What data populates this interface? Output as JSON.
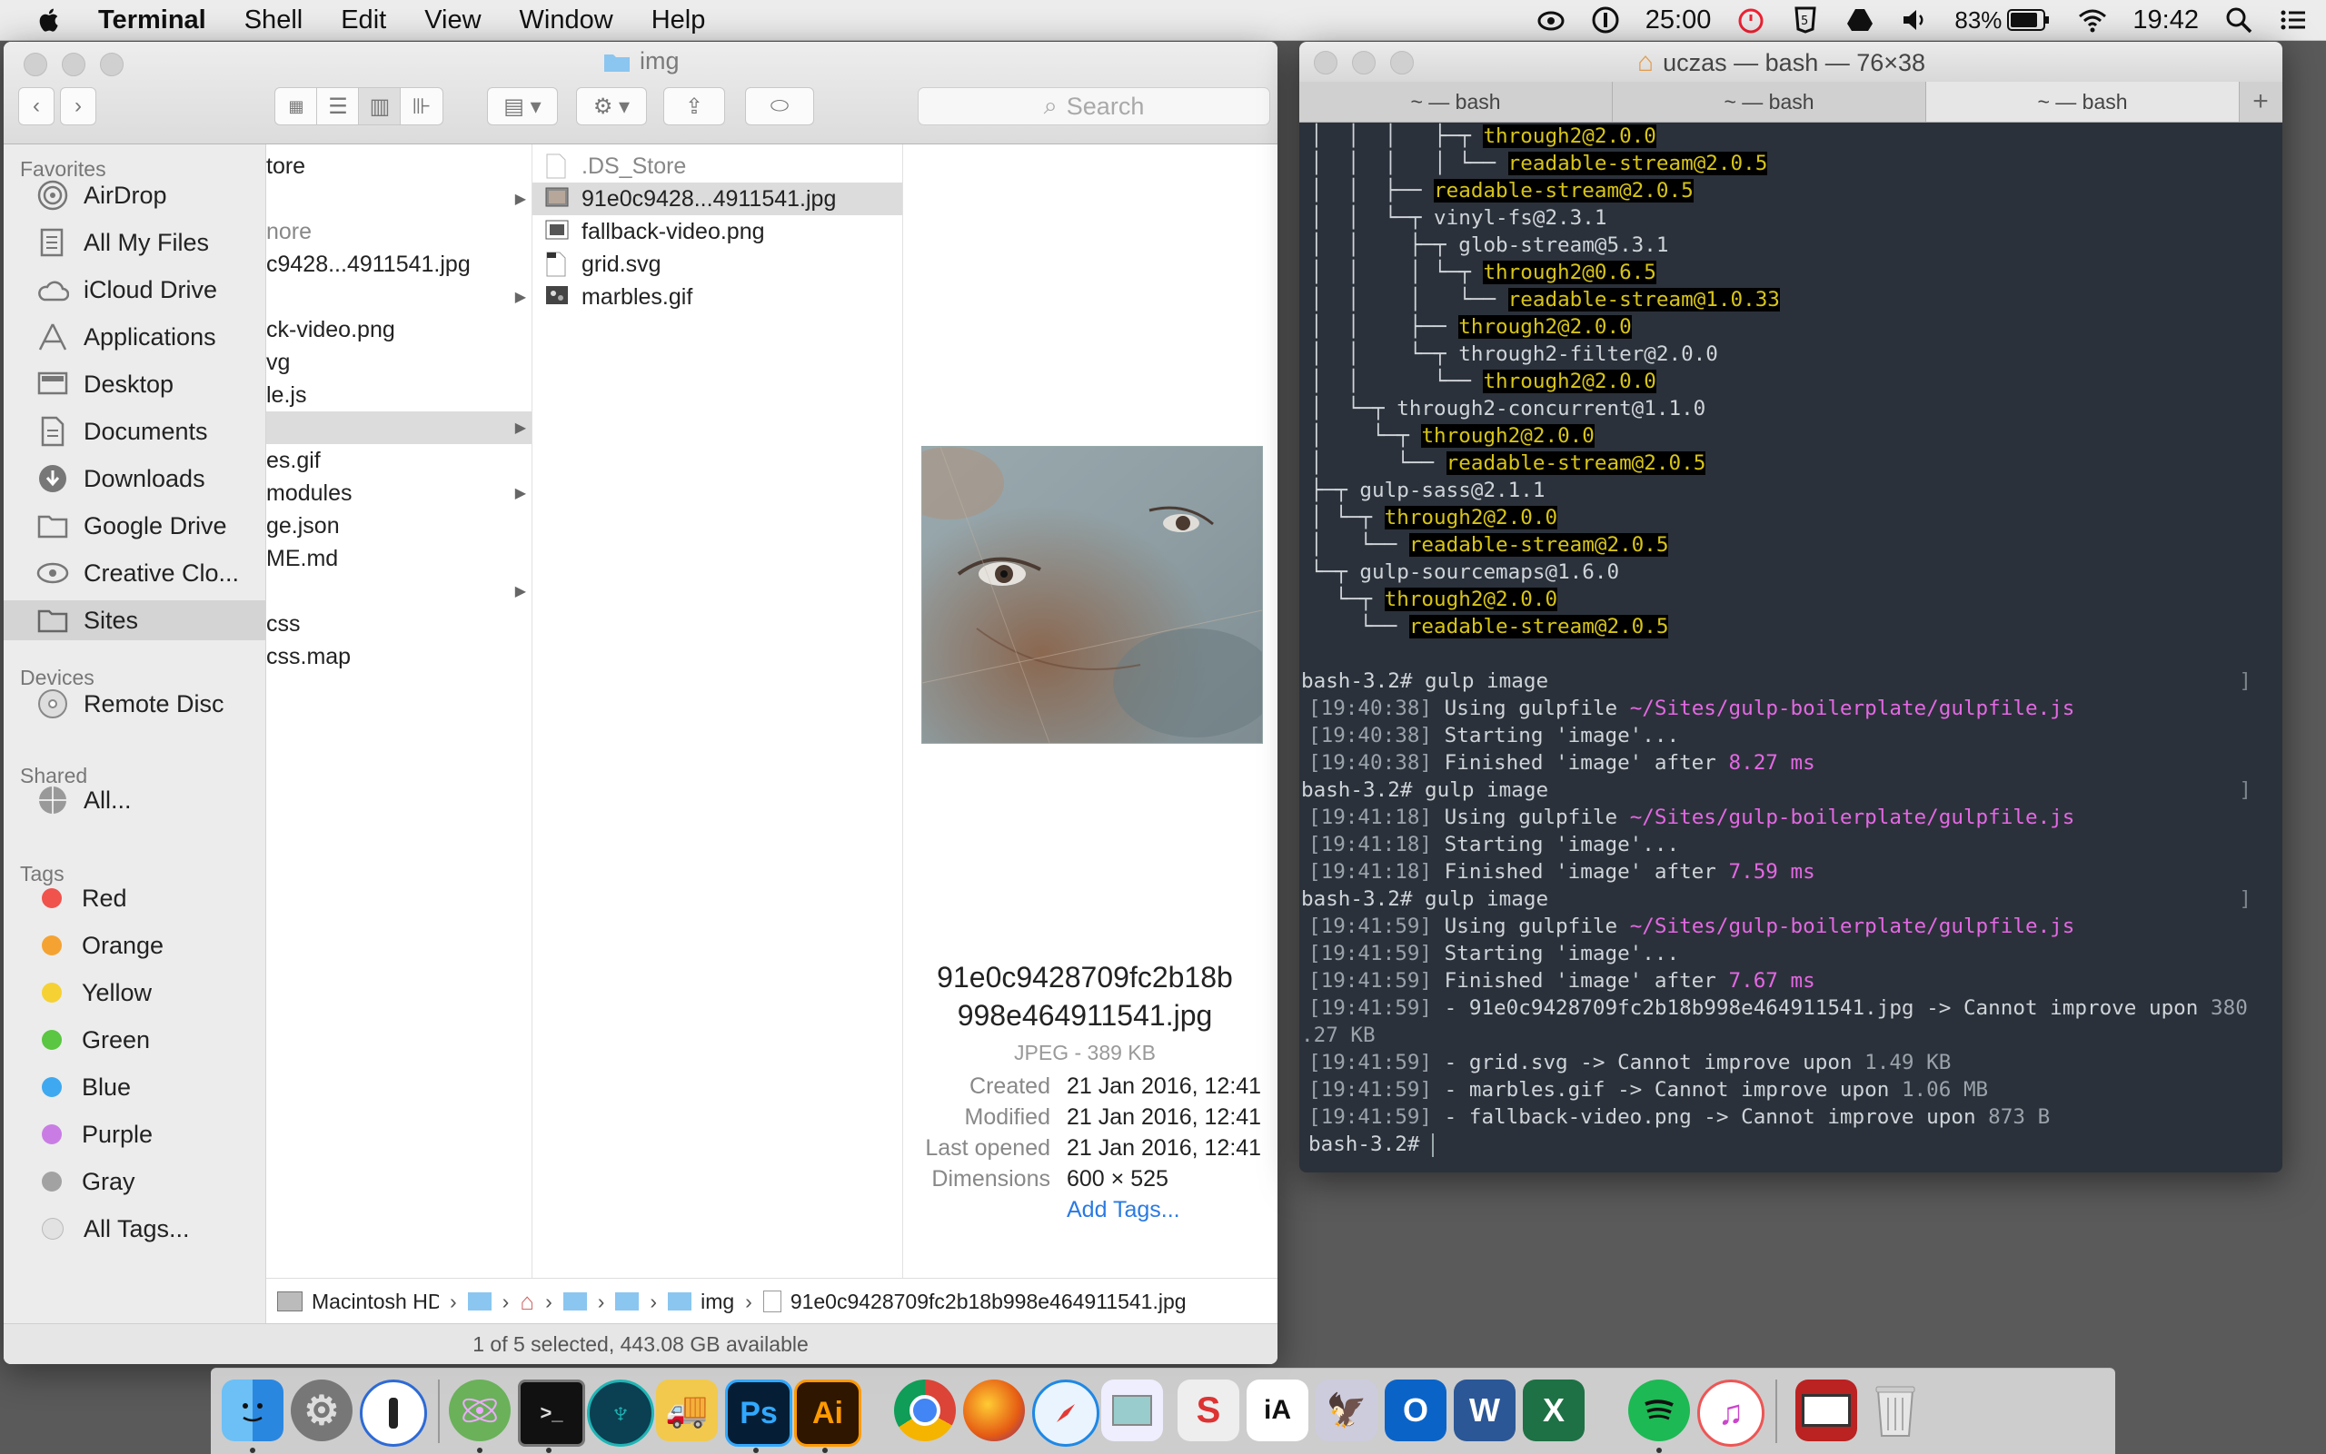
{
  "menubar": {
    "app": "Terminal",
    "items": [
      "Shell",
      "Edit",
      "View",
      "Window",
      "Help"
    ],
    "timer": "25:00",
    "battery": "83%",
    "clock": "19:42"
  },
  "finder": {
    "title": "img",
    "search_placeholder": "Search",
    "sidebar": {
      "favorites_header": "Favorites",
      "favorites": [
        "AirDrop",
        "All My Files",
        "iCloud Drive",
        "Applications",
        "Desktop",
        "Documents",
        "Downloads",
        "Google Drive",
        "Creative Clo...",
        "Sites"
      ],
      "devices_header": "Devices",
      "devices": [
        "Remote Disc"
      ],
      "shared_header": "Shared",
      "shared": [
        "All..."
      ],
      "tags_header": "Tags",
      "tags": [
        {
          "label": "Red",
          "color": "#f0534c"
        },
        {
          "label": "Orange",
          "color": "#f4a332"
        },
        {
          "label": "Yellow",
          "color": "#f6d134"
        },
        {
          "label": "Green",
          "color": "#5ac641"
        },
        {
          "label": "Blue",
          "color": "#3ea9f0"
        },
        {
          "label": "Purple",
          "color": "#c97de4"
        },
        {
          "label": "Gray",
          "color": "#a2a2a2"
        },
        {
          "label": "All Tags...",
          "color": "#e2e2e2"
        }
      ]
    },
    "column1": [
      "tore",
      "",
      "nore",
      "c9428...4911541.jpg",
      "",
      "ck-video.png",
      "vg",
      "le.js",
      "",
      "es.gif",
      "modules",
      "ge.json",
      "ME.md",
      "",
      "css",
      "css.map"
    ],
    "column2": [
      ".DS_Store",
      "91e0c9428...4911541.jpg",
      "fallback-video.png",
      "grid.svg",
      "marbles.gif"
    ],
    "preview": {
      "name_line1": "91e0c9428709fc2b18b",
      "name_line2": "998e464911541.jpg",
      "kind": "JPEG - 389 KB",
      "created_label": "Created",
      "created": "21 Jan 2016, 12:41",
      "modified_label": "Modified",
      "modified": "21 Jan 2016, 12:41",
      "opened_label": "Last opened",
      "opened": "21 Jan 2016, 12:41",
      "dimensions_label": "Dimensions",
      "dimensions": "600 × 525",
      "add_tags": "Add Tags..."
    },
    "pathbar": [
      "Macintosh HD",
      "img",
      "91e0c9428709fc2b18b998e464911541.jpg"
    ],
    "status": "1 of 5 selected, 443.08 GB available"
  },
  "terminal": {
    "title": "uczas — bash — 76×38",
    "tabs": [
      "~ — bash",
      "~ — bash",
      "~ — bash"
    ],
    "tree": [
      {
        "prefix": "│  │  │   ├─┬ ",
        "pkg": "through2@2.0.0"
      },
      {
        "prefix": "│  │  │   │ └── ",
        "pkg": "readable-stream@2.0.5"
      },
      {
        "prefix": "│  │  ├── ",
        "pkg": "readable-stream@2.0.5"
      },
      {
        "prefix": "│  │  └─┬ ",
        "plain": "vinyl-fs@2.3.1"
      },
      {
        "prefix": "│  │    ├─┬ ",
        "plain": "glob-stream@5.3.1"
      },
      {
        "prefix": "│  │    │ └─┬ ",
        "pkg": "through2@0.6.5"
      },
      {
        "prefix": "│  │    │   └── ",
        "pkg": "readable-stream@1.0.33"
      },
      {
        "prefix": "│  │    ├── ",
        "pkg": "through2@2.0.0"
      },
      {
        "prefix": "│  │    └─┬ ",
        "plain": "through2-filter@2.0.0"
      },
      {
        "prefix": "│  │      └── ",
        "pkg": "through2@2.0.0"
      },
      {
        "prefix": "│  └─┬ ",
        "plain": "through2-concurrent@1.1.0"
      },
      {
        "prefix": "│    └─┬ ",
        "pkg": "through2@2.0.0"
      },
      {
        "prefix": "│      └── ",
        "pkg": "readable-stream@2.0.5"
      },
      {
        "prefix": "├─┬ ",
        "plain": "gulp-sass@2.1.1"
      },
      {
        "prefix": "│ └─┬ ",
        "pkg": "through2@2.0.0"
      },
      {
        "prefix": "│   └── ",
        "pkg": "readable-stream@2.0.5"
      },
      {
        "prefix": "└─┬ ",
        "plain": "gulp-sourcemaps@1.6.0"
      },
      {
        "prefix": "  └─┬ ",
        "pkg": "through2@2.0.0"
      },
      {
        "prefix": "    └── ",
        "pkg": "readable-stream@2.0.5"
      }
    ],
    "log": [
      {
        "type": "prompt",
        "text": "bash-3.2# gulp image"
      },
      {
        "ts": "[19:40:38]",
        "a": " Using gulpfile ",
        "p": "~/Sites/gulp-boilerplate/gulpfile.js"
      },
      {
        "ts": "[19:40:38]",
        "a": " Starting 'image'..."
      },
      {
        "ts": "[19:40:38]",
        "a": " Finished 'image' after ",
        "p": "8.27 ms"
      },
      {
        "type": "prompt",
        "text": "bash-3.2# gulp image"
      },
      {
        "ts": "[19:41:18]",
        "a": " Using gulpfile ",
        "p": "~/Sites/gulp-boilerplate/gulpfile.js"
      },
      {
        "ts": "[19:41:18]",
        "a": " Starting 'image'..."
      },
      {
        "ts": "[19:41:18]",
        "a": " Finished 'image' after ",
        "p": "7.59 ms"
      },
      {
        "type": "prompt",
        "text": "bash-3.2# gulp image"
      },
      {
        "ts": "[19:41:59]",
        "a": " Using gulpfile ",
        "p": "~/Sites/gulp-boilerplate/gulpfile.js"
      },
      {
        "ts": "[19:41:59]",
        "a": " Starting 'image'..."
      },
      {
        "ts": "[19:41:59]",
        "a": " Finished 'image' after ",
        "p": "7.67 ms"
      },
      {
        "ts": "[19:41:59]",
        "a": " - 91e0c9428709fc2b18b998e464911541.jpg -> Cannot improve upon ",
        "g": "380"
      },
      {
        "cont": ".27 KB"
      },
      {
        "ts": "[19:41:59]",
        "a": " - grid.svg -> Cannot improve upon ",
        "g": "1.49 KB"
      },
      {
        "ts": "[19:41:59]",
        "a": " - marbles.gif -> Cannot improve upon ",
        "g": "1.06 MB"
      },
      {
        "ts": "[19:41:59]",
        "a": " - fallback-video.png -> Cannot improve upon ",
        "g": "873 B"
      },
      {
        "type": "cursor",
        "text": "bash-3.2# "
      }
    ]
  },
  "dock": {
    "apps": [
      "finder-icon",
      "system-preferences-icon",
      "1password-icon",
      "atom-icon",
      "terminal-icon",
      "gitkraken-icon",
      "transmit-icon",
      "photoshop-icon",
      "illustrator-icon",
      "chrome-icon",
      "firefox-icon",
      "safari-icon",
      "preview-icon",
      "sketch-icon",
      "ia-writer-icon",
      "migration-icon",
      "outlook-icon",
      "word-icon",
      "excel-icon",
      "spotify-icon",
      "itunes-icon",
      "photo-booth-icon",
      "trash-icon"
    ],
    "ps_label": "Ps",
    "ai_label": "Ai",
    "ia_label": "iA"
  }
}
